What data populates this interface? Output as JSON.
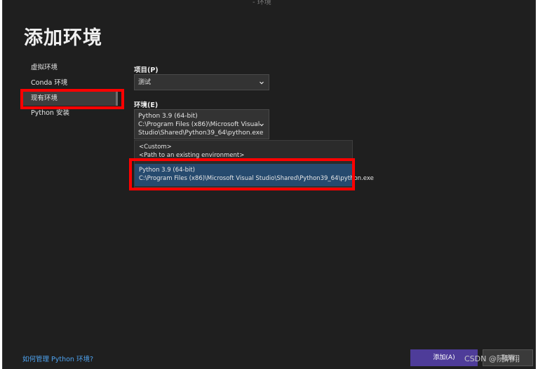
{
  "window": {
    "title_mark": "- 环境"
  },
  "page_title": "添加环境",
  "sidebar": {
    "items": [
      {
        "label": "虚拟环境"
      },
      {
        "label": "Conda 环境"
      },
      {
        "label": "现有环境",
        "selected": true
      },
      {
        "label": "Python 安装"
      }
    ]
  },
  "project": {
    "label": "项目(P)",
    "selected_value": "测试"
  },
  "environment": {
    "label": "环境(E)",
    "selected_line1": "Python 3.9 (64-bit)",
    "selected_line2": "C:\\Program Files (x86)\\Microsoft Visual",
    "selected_line3": "Studio\\Shared\\Python39_64\\python.exe",
    "options": [
      {
        "line1": "<Custom>",
        "line2": "<Path to an existing environment>"
      },
      {
        "line1": "Python 3.9 (64-bit)",
        "line2": "C:\\Program Files (x86)\\Microsoft Visual Studio\\Shared\\Python39_64\\python.exe",
        "highlighted": true
      }
    ]
  },
  "footer": {
    "help_link": "如何管理 Python 环境?",
    "add_button": "添加(A)",
    "cancel_button": "取消"
  },
  "watermark": "CSDN @阮炳翔",
  "colors": {
    "background": "#1f1f1f",
    "annotation_red": "#ff0000",
    "add_button": "#4e3c99",
    "link": "#4ea3f0",
    "highlight": "#264a6e"
  },
  "icons": {
    "dropdown": "chevron-down-icon"
  }
}
